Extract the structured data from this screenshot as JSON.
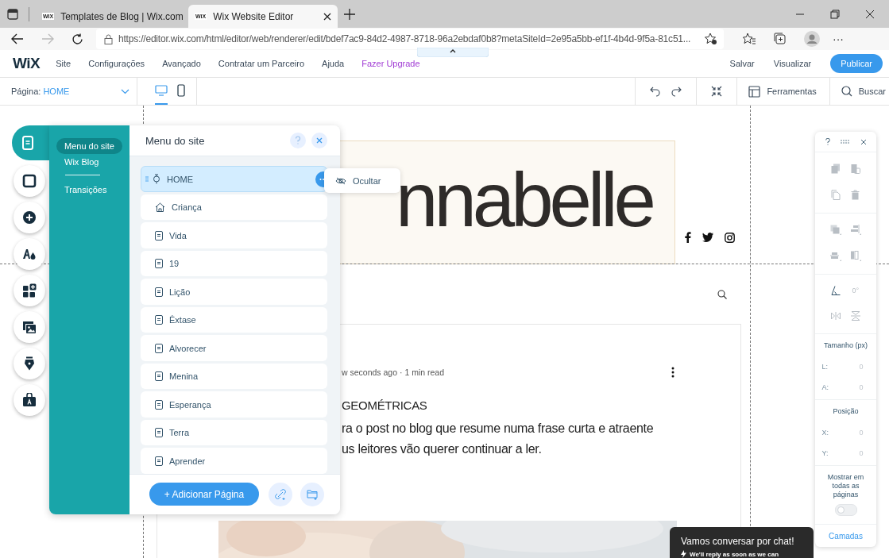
{
  "browser": {
    "tabs": [
      {
        "badge": "WiX",
        "title": "Templates de Blog | Wix.com",
        "selected": false
      },
      {
        "badge": "WiX",
        "title": "Wix Website Editor",
        "selected": true
      }
    ],
    "url": "https://editor.wix.com/html/editor/web/renderer/edit/bdef7ac9-84d2-4987-8718-96a2ebdaf0b8?metaSiteId=2e95a5bb-ef1f-4b4d-9f5a-81c51...",
    "more": "···"
  },
  "topbar": {
    "logo": "WiX",
    "menu": [
      {
        "label": "Site",
        "kind": "normal"
      },
      {
        "label": "Configurações",
        "kind": "normal"
      },
      {
        "label": "Avançado",
        "kind": "normal"
      },
      {
        "label": "Contratar um Parceiro",
        "kind": "normal"
      },
      {
        "label": "Ajuda",
        "kind": "normal"
      },
      {
        "label": "Fazer Upgrade",
        "kind": "upgrade"
      }
    ],
    "save": "Salvar",
    "preview": "Visualizar",
    "publish": "Publicar"
  },
  "toolbar": {
    "page_label": "Página:",
    "page_value": "HOME",
    "views": [
      {
        "kind": "desktop",
        "selected": true
      },
      {
        "kind": "mobile",
        "selected": false
      }
    ],
    "tools": "Ferramentas",
    "search": "Buscar"
  },
  "rail": [
    {
      "kind": "pages",
      "selected": true
    },
    {
      "kind": "background",
      "selected": false
    },
    {
      "kind": "add",
      "selected": false
    },
    {
      "kind": "design",
      "selected": false
    },
    {
      "kind": "apps",
      "selected": false
    },
    {
      "kind": "media",
      "selected": false
    },
    {
      "kind": "blog",
      "selected": false
    },
    {
      "kind": "market",
      "selected": false
    }
  ],
  "panel": {
    "sections": [
      {
        "label": "Menu do site",
        "selected": true
      },
      {
        "label": "Wix Blog",
        "selected": false
      },
      {
        "label": "Transições",
        "selected": false
      }
    ],
    "title": "Menu do site",
    "pages": [
      {
        "label": "HOME",
        "kind": "pinned",
        "selected": true
      },
      {
        "label": "Criança",
        "kind": "home",
        "selected": false
      },
      {
        "label": "Vida",
        "kind": "page",
        "selected": false
      },
      {
        "label": "19",
        "kind": "page",
        "selected": false
      },
      {
        "label": "Lição",
        "kind": "page",
        "selected": false
      },
      {
        "label": "Êxtase",
        "kind": "page",
        "selected": false
      },
      {
        "label": "Alvorecer",
        "kind": "page",
        "selected": false
      },
      {
        "label": "Menina",
        "kind": "page",
        "selected": false
      },
      {
        "label": "Esperança",
        "kind": "page",
        "selected": false
      },
      {
        "label": "Terra",
        "kind": "page",
        "selected": false
      },
      {
        "label": "Aprender",
        "kind": "page",
        "selected": false
      }
    ],
    "popup": "Ocultar",
    "add_page": "+ Adicionar Página"
  },
  "site": {
    "logo": "nnabelle",
    "post_meta": "w seconds ago · 1 min read",
    "post_title": "GEOMÉTRICAS",
    "excerpt": [
      "ra o post no blog que resume numa frase curta e atraente",
      "us leitores vão querer continuar a ler."
    ]
  },
  "tools_panel": {
    "rotation": "0°",
    "size_label": "Tamanho (px)",
    "size_fields": [
      {
        "label": "L:",
        "value": "0"
      },
      {
        "label": "A:",
        "value": "0"
      }
    ],
    "position_label": "Posição",
    "position_fields": [
      {
        "label": "X:",
        "value": "0"
      },
      {
        "label": "Y:",
        "value": "0"
      }
    ],
    "show_all": {
      "label": "Mostrar em todas as páginas",
      "on": false
    },
    "layers": "Camadas"
  },
  "chat": {
    "title": "Vamos conversar por chat!",
    "subtitle": "We'll reply as soon as we can"
  }
}
